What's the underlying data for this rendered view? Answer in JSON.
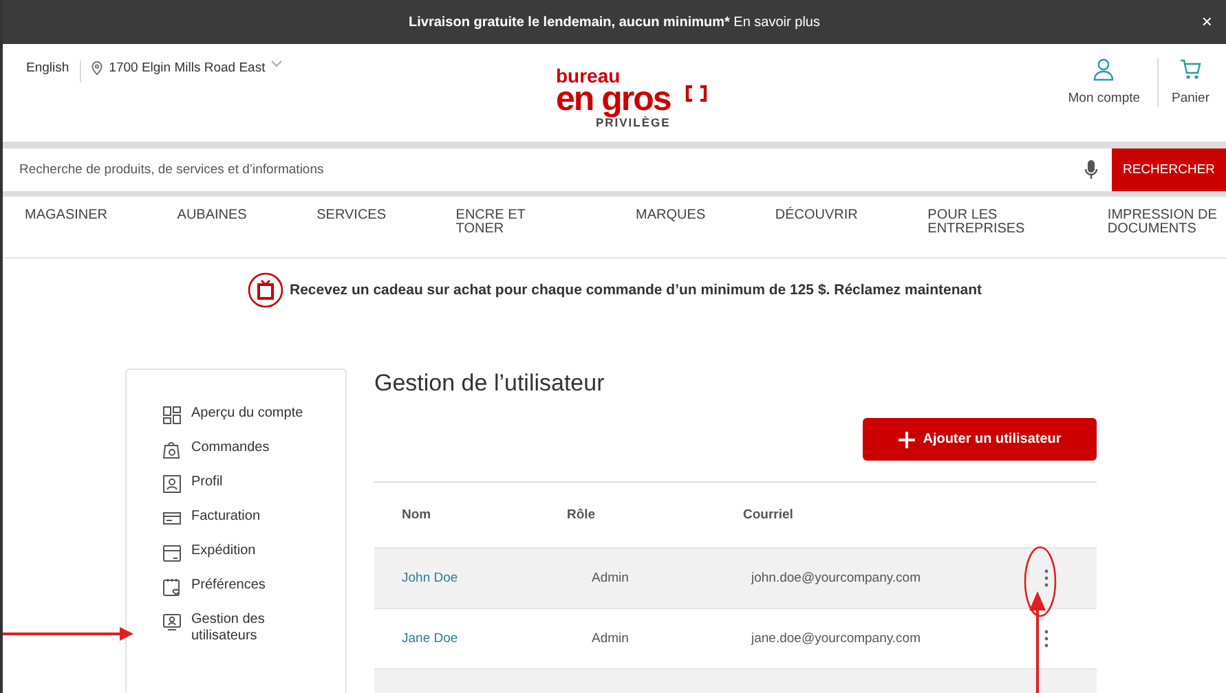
{
  "banner": {
    "message": "Livraison gratuite le lendemain, aucun minimum*",
    "link": "En savoir plus",
    "close": "×"
  },
  "header": {
    "language": "English",
    "location": "1700 Elgin Mills Road East",
    "logo": {
      "line1": "bureau",
      "line2": "en gros",
      "tagline": "PRIVILÈGE"
    },
    "actions": [
      {
        "label": "Mon compte",
        "kind": "account"
      },
      {
        "label": "Panier",
        "kind": "cart"
      }
    ]
  },
  "search": {
    "placeholder": "Recherche de produits, de services et d’informations",
    "button": "RECHERCHER"
  },
  "nav": [
    "MAGASINER",
    "AUBAINES",
    "SERVICES",
    "ENCRE ET TONER",
    "MARQUES",
    "DÉCOUVRIR",
    "POUR LES ENTREPRISES",
    "IMPRESSION DE DOCUMENTS"
  ],
  "promo": "Recevez un cadeau sur achat pour chaque commande d’un minimum de 125 $. Réclamez maintenant",
  "sidebar": {
    "items": [
      {
        "label": "Aperçu du compte",
        "kind": "overview"
      },
      {
        "label": "Commandes",
        "kind": "orders"
      },
      {
        "label": "Profil",
        "kind": "profile"
      },
      {
        "label": "Facturation",
        "kind": "billing"
      },
      {
        "label": "Expédition",
        "kind": "shipping"
      },
      {
        "label": "Préférences",
        "kind": "preferences"
      },
      {
        "label": "Gestion des utilisateurs",
        "kind": "users"
      }
    ]
  },
  "main": {
    "title": "Gestion de l’utilisateur",
    "add_button": "Ajouter un utilisateur",
    "table": {
      "columns": [
        "Nom",
        "Rôle",
        "Courriel"
      ],
      "rows": [
        {
          "name": "John Doe",
          "role": "Admin",
          "email": "john.doe@yourcompany.com"
        },
        {
          "name": "Jane Doe",
          "role": "Admin",
          "email": "jane.doe@yourcompany.com"
        }
      ]
    }
  }
}
